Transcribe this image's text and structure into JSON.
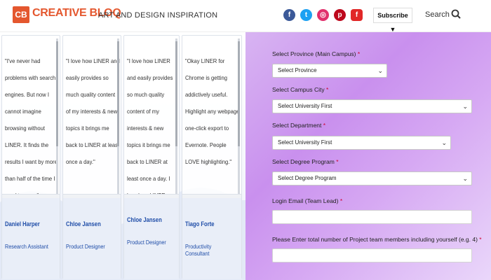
{
  "header": {
    "logo_badge": "CB",
    "logo_text": "CREATIVE BLOQ",
    "tagline": "ART AND DESIGN INSPIRATION",
    "socials": [
      {
        "icon": "facebook-icon",
        "glyph": "f",
        "color": "#3b5998"
      },
      {
        "icon": "twitter-icon",
        "glyph": "t",
        "color": "#1da1f2"
      },
      {
        "icon": "instagram-icon",
        "glyph": "◎",
        "color": "#e1306c"
      },
      {
        "icon": "pinterest-icon",
        "glyph": "p",
        "color": "#bd081c"
      },
      {
        "icon": "flipboard-icon",
        "glyph": "f",
        "color": "#e12828"
      }
    ],
    "subscribe_label": "Subscribe ▼",
    "search_label": "Search"
  },
  "testimonials": [
    {
      "quote": "\"I've never had problems with search engines. But now I cannot imagine browsing without LINER. It finds the results I want by more than half of the time I used to save.\"",
      "name": "Daniel Harper",
      "role": "Research Assistant"
    },
    {
      "quote": "\"I love how LINER and easily provides so much quality content of my interests & new topics it brings me back to LINER at least once a day.\"",
      "name": "Chloe Jansen",
      "role": "Product Designer"
    },
    {
      "quote": "\"I love how LINER and easily provides so much quality content of my interests & new topics it brings me back to LINER at least once a day. I love how LINER endlessly provides so much quality content of my",
      "name": "Chloe Jansen",
      "role": "Product Designer"
    },
    {
      "quote": "\"Okay LINER for Chrome is getting addictively useful. Highlight any webpage one-click export to Evernote. People LOVE highlighting.\"",
      "name": "Tiago Forte",
      "role": "Productivity Consultant"
    }
  ],
  "form": {
    "province": {
      "label": "Select Province (Main Campus)",
      "value": "Select Province"
    },
    "campus_city": {
      "label": "Select Campus City",
      "value": "Select University First"
    },
    "department": {
      "label": "Select Department",
      "value": "Select University First"
    },
    "degree": {
      "label": "Select Degree Program",
      "value": "Select Degree Program"
    },
    "login_email": {
      "label": "Login Email (Team Lead)",
      "value": ""
    },
    "team_members": {
      "label": "Please Enter total number of Project team members including yourself (e.g. 4)",
      "value": ""
    },
    "required_mark": "*"
  }
}
